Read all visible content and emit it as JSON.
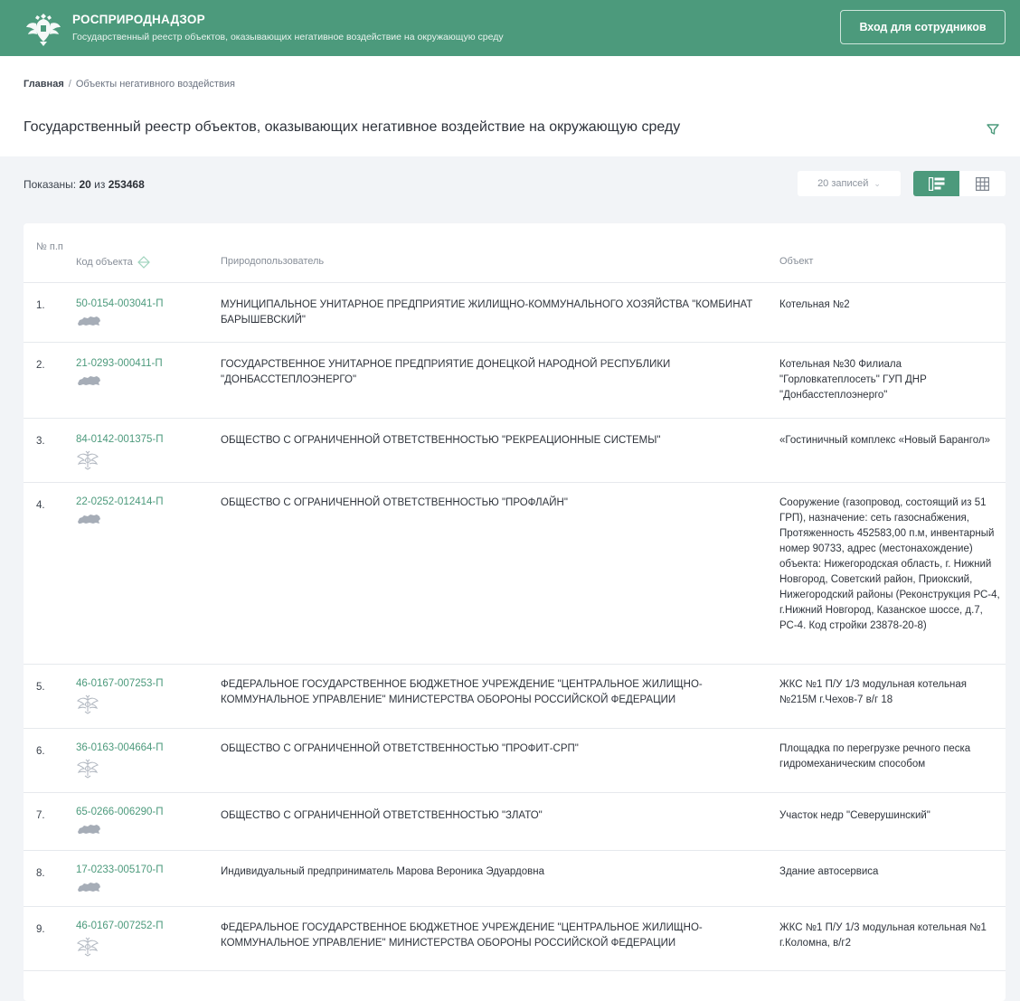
{
  "header": {
    "brand_name": "РОСПРИРОДНАДЗОР",
    "brand_sub": "Государственный реестр объектов, оказывающих негативное воздействие на окружающую среду",
    "login_label": "Вход для сотрудников",
    "emblem_icon": "coat-of-arms-icon"
  },
  "breadcrumb": {
    "home": "Главная",
    "separator": "/",
    "current": "Объекты негативного воздействия"
  },
  "page_title": "Государственный реестр объектов, оказывающих негативное воздействие на окружающую среду",
  "toolbar": {
    "shown_label": "Показаны:",
    "shown_count": "20",
    "shown_of": "из",
    "shown_total": "253468",
    "per_page": "20 записей"
  },
  "table": {
    "headers": {
      "num": "№ п.п",
      "code": "Код объекта",
      "user": "Природопользователь",
      "object": "Объект"
    },
    "rows": [
      {
        "num": "1.",
        "code": "50-0154-003041-П",
        "icon": "russia-map-icon",
        "user": "МУНИЦИПАЛЬНОЕ УНИТАРНОЕ ПРЕДПРИЯТИЕ ЖИЛИЩНО-КОММУНАЛЬНОГО ХОЗЯЙСТВА \"КОМБИНАТ БАРЫШЕВСКИЙ\"",
        "object": "Котельная №2"
      },
      {
        "num": "2.",
        "code": "21-0293-000411-П",
        "icon": "russia-map-icon",
        "user": "ГОСУДАРСТВЕННОЕ УНИТАРНОЕ ПРЕДПРИЯТИЕ ДОНЕЦКОЙ НАРОДНОЙ РЕСПУБЛИКИ \"ДОНБАССТЕПЛОЭНЕРГО\"",
        "object": "Котельная №30 Филиала \"Горловкатеплосеть\" ГУП ДНР \"Донбасстеплоэнерго\""
      },
      {
        "num": "3.",
        "code": "84-0142-001375-П",
        "icon": "eagle-emblem-icon",
        "user": "ОБЩЕСТВО С ОГРАНИЧЕННОЙ ОТВЕТСТВЕННОСТЬЮ \"РЕКРЕАЦИОННЫЕ СИСТЕМЫ\"",
        "object": "«Гостиничный комплекс «Новый Барангол»"
      },
      {
        "num": "4.",
        "code": "22-0252-012414-П",
        "icon": "russia-map-icon",
        "user": "ОБЩЕСТВО С ОГРАНИЧЕННОЙ ОТВЕТСТВЕННОСТЬЮ \"ПРОФЛАЙН\"",
        "object": "Сооружение (газопровод, состоящий из 51 ГРП), назначение: сеть газоснабжения, Протяженность 452583,00 п.м, инвентарный номер 90733, адрес (местонахождение) объекта: Нижегородская область, г. Нижний Новгород, Советский район, Приокский, Нижегородский районы (Реконструкция РС-4, г.Нижний Новгород, Казанское шоссе, д.7, РС-4. Код стройки 23878-20-8)"
      },
      {
        "num": "5.",
        "code": "46-0167-007253-П",
        "icon": "eagle-emblem-icon",
        "user": "ФЕДЕРАЛЬНОЕ ГОСУДАРСТВЕННОЕ БЮДЖЕТНОЕ УЧРЕЖДЕНИЕ \"ЦЕНТРАЛЬНОЕ ЖИЛИЩНО-КОММУНАЛЬНОЕ УПРАВЛЕНИЕ\" МИНИСТЕРСТВА ОБОРОНЫ РОССИЙСКОЙ ФЕДЕРАЦИИ",
        "object": "ЖКС №1 П/У 1/3 модульная котельная №215М г.Чехов-7 в/г 18"
      },
      {
        "num": "6.",
        "code": "36-0163-004664-П",
        "icon": "eagle-emblem-icon",
        "user": "ОБЩЕСТВО С ОГРАНИЧЕННОЙ ОТВЕТСТВЕННОСТЬЮ \"ПРОФИТ-СРП\"",
        "object": "Площадка по перегрузке речного песка гидромеханическим способом"
      },
      {
        "num": "7.",
        "code": "65-0266-006290-П",
        "icon": "russia-map-icon",
        "user": "ОБЩЕСТВО С ОГРАНИЧЕННОЙ ОТВЕТСТВЕННОСТЬЮ \"ЗЛАТО\"",
        "object": "Участок недр \"Северушинский\""
      },
      {
        "num": "8.",
        "code": "17-0233-005170-П",
        "icon": "russia-map-icon",
        "user": "Индивидуальный предприниматель Марова Вероника Эдуардовна",
        "object": "Здание автосервиса"
      },
      {
        "num": "9.",
        "code": "46-0167-007252-П",
        "icon": "eagle-emblem-icon",
        "user": "ФЕДЕРАЛЬНОЕ ГОСУДАРСТВЕННОЕ БЮДЖЕТНОЕ УЧРЕЖДЕНИЕ \"ЦЕНТРАЛЬНОЕ ЖИЛИЩНО-КОММУНАЛЬНОЕ УПРАВЛЕНИЕ\" МИНИСТЕРСТВА ОБОРОНЫ РОССИЙСКОЙ ФЕДЕРАЦИИ",
        "object": "ЖКС №1 П/У 1/3 модульная котельная №1 г.Коломна, в/г2"
      }
    ]
  },
  "colors": {
    "brand": "#4c9a7c",
    "link": "#4c9a7c",
    "background": "#f2f4f7",
    "icon_gray": "#a6adb7"
  }
}
